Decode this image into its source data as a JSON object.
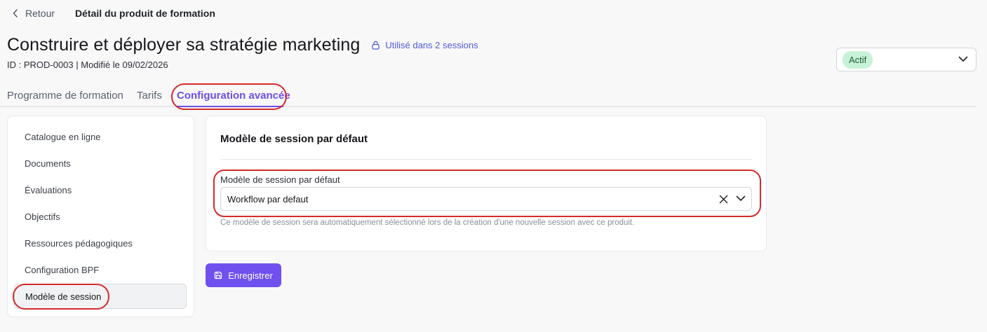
{
  "header": {
    "back_label": "Retour",
    "breadcrumb_title": "Détail du produit de formation",
    "title": "Construire et déployer sa stratégie marketing",
    "usage_label": "Utilisé dans 2 sessions",
    "meta": "ID : PROD-0003 | Modifié le 09/02/2026"
  },
  "status": {
    "value": "Actif"
  },
  "tabs": [
    {
      "label": "Programme de formation"
    },
    {
      "label": "Tarifs"
    },
    {
      "label": "Configuration avancée"
    }
  ],
  "sidebar": {
    "items": [
      {
        "label": "Catalogue en ligne"
      },
      {
        "label": "Documents"
      },
      {
        "label": "Évaluations"
      },
      {
        "label": "Objectifs"
      },
      {
        "label": "Ressources pédagogiques"
      },
      {
        "label": "Configuration BPF"
      },
      {
        "label": "Modèle de session"
      }
    ]
  },
  "card": {
    "title": "Modèle de session par défaut",
    "field_label": "Modèle de session par défaut",
    "field_value": "Workflow par defaut",
    "help_text": "Ce modèle de session sera automatiquement sélectionné lors de la création d'une nouvelle session avec ce produit."
  },
  "actions": {
    "save_label": "Enregistrer"
  },
  "colors": {
    "accent": "#7050ef",
    "status_badge_bg": "#c7f2d8",
    "link": "#4f5bd5",
    "annotation": "#d62b2b"
  }
}
